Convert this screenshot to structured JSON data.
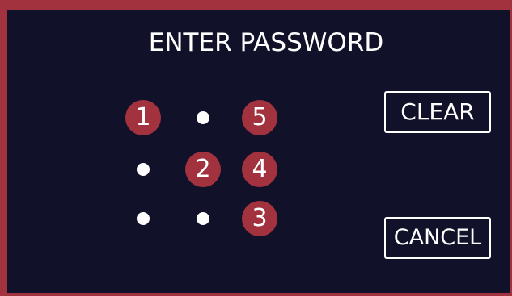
{
  "title": "ENTER PASSWORD",
  "buttons": {
    "clear_label": "CLEAR",
    "cancel_label": "CANCEL"
  },
  "pattern": {
    "rows": 3,
    "cols": 3,
    "selected_order": [
      {
        "row": 1,
        "col": 1,
        "label": "1"
      },
      {
        "row": 2,
        "col": 2,
        "label": "2"
      },
      {
        "row": 3,
        "col": 3,
        "label": "3"
      },
      {
        "row": 2,
        "col": 3,
        "label": "4"
      },
      {
        "row": 1,
        "col": 3,
        "label": "5"
      }
    ]
  },
  "colors": {
    "background": "#11112a",
    "frame": "#a3323f",
    "selected": "#a3323f",
    "dot": "#ffffff",
    "text": "#ffffff"
  }
}
